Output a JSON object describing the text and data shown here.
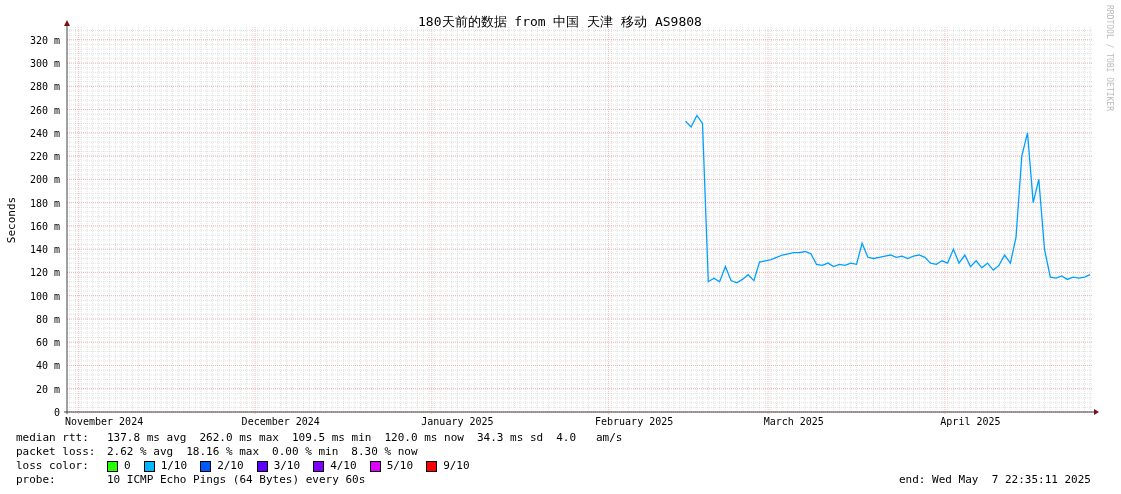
{
  "graph": {
    "title": "180天前的数据 from 中国 天津 移动 AS9808",
    "credit": "RRDTOOL / TOBI OETIKER",
    "chart_data": {
      "type": "line",
      "ylabel": "Seconds",
      "ylim": [
        0,
        331
      ],
      "grid": true,
      "yticks": [
        {
          "value": 0,
          "label": "0"
        },
        {
          "value": 20,
          "label": "20 m"
        },
        {
          "value": 40,
          "label": "40 m"
        },
        {
          "value": 60,
          "label": "60 m"
        },
        {
          "value": 80,
          "label": "80 m"
        },
        {
          "value": 100,
          "label": "100 m"
        },
        {
          "value": 120,
          "label": "120 m"
        },
        {
          "value": 140,
          "label": "140 m"
        },
        {
          "value": 160,
          "label": "160 m"
        },
        {
          "value": 180,
          "label": "180 m"
        },
        {
          "value": 200,
          "label": "200 m"
        },
        {
          "value": 220,
          "label": "220 m"
        },
        {
          "value": 240,
          "label": "240 m"
        },
        {
          "value": 260,
          "label": "260 m"
        },
        {
          "value": 280,
          "label": "280 m"
        },
        {
          "value": 300,
          "label": "300 m"
        },
        {
          "value": 320,
          "label": "320 m"
        }
      ],
      "categories": [
        null,
        null,
        null,
        null,
        null,
        null,
        "November 2024",
        null,
        null,
        null,
        null,
        null,
        null,
        null,
        null,
        null,
        null,
        null,
        null,
        null,
        null,
        null,
        null,
        null,
        null,
        null,
        null,
        null,
        null,
        null,
        null,
        null,
        null,
        null,
        null,
        null,
        null,
        "December 2024",
        null,
        null,
        null,
        null,
        null,
        null,
        null,
        null,
        null,
        null,
        null,
        null,
        null,
        null,
        null,
        null,
        null,
        null,
        null,
        null,
        null,
        null,
        null,
        null,
        null,
        null,
        null,
        null,
        null,
        null,
        "January 2025",
        null,
        null,
        null,
        null,
        null,
        null,
        null,
        null,
        null,
        null,
        null,
        null,
        null,
        null,
        null,
        null,
        null,
        null,
        null,
        null,
        null,
        null,
        null,
        null,
        null,
        null,
        null,
        null,
        null,
        null,
        "February 2025",
        null,
        null,
        null,
        null,
        null,
        null,
        null,
        null,
        null,
        null,
        null,
        null,
        null,
        null,
        null,
        null,
        null,
        null,
        null,
        null,
        null,
        null,
        null,
        null,
        null,
        null,
        null,
        "March 2025",
        null,
        null,
        null,
        null,
        null,
        null,
        null,
        null,
        null,
        null,
        null,
        null,
        null,
        null,
        null,
        null,
        null,
        null,
        null,
        null,
        null,
        null,
        null,
        null,
        null,
        null,
        null,
        null,
        null,
        null,
        "April 2025",
        null,
        null,
        null,
        null,
        null,
        null,
        null,
        null,
        null,
        null,
        null,
        null,
        null,
        null,
        null,
        null,
        null,
        null,
        null,
        null,
        null
      ],
      "series": [
        {
          "color": "#00a0ff",
          "values": [
            null,
            null,
            null,
            null,
            null,
            null,
            null,
            null,
            null,
            null,
            null,
            null,
            null,
            null,
            null,
            null,
            null,
            null,
            null,
            null,
            null,
            null,
            null,
            null,
            null,
            null,
            null,
            null,
            null,
            null,
            null,
            null,
            null,
            null,
            null,
            null,
            null,
            null,
            null,
            null,
            null,
            null,
            null,
            null,
            null,
            null,
            null,
            null,
            null,
            null,
            null,
            null,
            null,
            null,
            null,
            null,
            null,
            null,
            null,
            null,
            null,
            null,
            null,
            null,
            null,
            null,
            null,
            null,
            null,
            null,
            null,
            null,
            null,
            null,
            null,
            null,
            null,
            null,
            null,
            null,
            null,
            null,
            null,
            null,
            null,
            null,
            null,
            null,
            null,
            null,
            null,
            null,
            null,
            null,
            null,
            null,
            null,
            null,
            null,
            null,
            null,
            null,
            null,
            null,
            null,
            null,
            null,
            null,
            250,
            245,
            255,
            248,
            112,
            115,
            112,
            125,
            113,
            111,
            114,
            118,
            113,
            129,
            130,
            131,
            133,
            135,
            136,
            137,
            137,
            138,
            136,
            127,
            126,
            128,
            125,
            127,
            126,
            128,
            127,
            145,
            133,
            132,
            133,
            134,
            135,
            133,
            134,
            132,
            134,
            135,
            133,
            128,
            127,
            130,
            128,
            140,
            128,
            135,
            125,
            130,
            124,
            128,
            122,
            126,
            135,
            128,
            150,
            220,
            240,
            180,
            200,
            140,
            116,
            115,
            117,
            114,
            116,
            115,
            116,
            118
          ]
        }
      ]
    }
  },
  "legend": [
    {
      "kind": "stats",
      "label": "median rtt:",
      "values": [
        "137.8 ms avg",
        "262.0 ms max",
        "109.5 ms min",
        "120.0 ms now",
        "34.3 ms sd",
        "4.0   am/s"
      ]
    },
    {
      "kind": "stats",
      "label": "packet loss:",
      "values": [
        "2.62 % avg",
        "18.16 % max",
        "0.00 % min",
        "8.30 % now"
      ]
    },
    {
      "kind": "colors",
      "label": "loss color:",
      "items": [
        {
          "label": "0",
          "color": "#26ff00"
        },
        {
          "label": "1/10",
          "color": "#00b8ff"
        },
        {
          "label": "2/10",
          "color": "#0059ff"
        },
        {
          "label": "3/10",
          "color": "#5e00ff"
        },
        {
          "label": "4/10",
          "color": "#7e00ff"
        },
        {
          "label": "5/10",
          "color": "#dd00ff"
        },
        {
          "label": "9/10",
          "color": "#ff0000"
        }
      ]
    },
    {
      "kind": "probe",
      "label": "probe:",
      "text": "10 ICMP Echo Pings (64 Bytes) every 60s",
      "end": "end: Wed May  7 22:35:11 2025"
    }
  ]
}
